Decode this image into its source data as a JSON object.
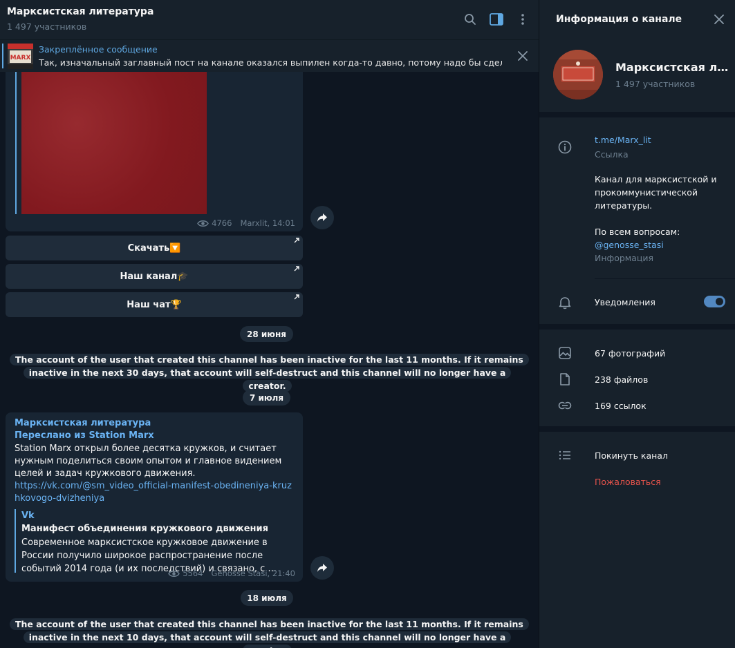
{
  "chat": {
    "title": "Марксистская литература",
    "subtitle": "1 497 участников"
  },
  "pinned": {
    "title": "Закреплённое сообщение",
    "text": "Так, изначальный заглавный пост на канале оказался выпилен когда-то давно, потому надо бы сделать ..."
  },
  "photo_post": {
    "views": "4766",
    "signature": "Marxlit, 14:01"
  },
  "buttons": [
    {
      "label": "Скачать🔽"
    },
    {
      "label": "Наш канал🎓"
    },
    {
      "label": "Наш чат🏆"
    }
  ],
  "dates": {
    "d1": "28 июня",
    "d2": "7 июля",
    "d3": "18 июля"
  },
  "service": {
    "s1": "The account of the user that created this channel has been inactive for the last 11 months. If it remains inactive in the next 30 days, that account will self-destruct and this channel will no longer have a creator.",
    "s2": "The account of the user that created this channel has been inactive for the last 11 months. If it remains inactive in the next 10 days, that account will self-destruct and this channel will no longer have a creator."
  },
  "forward_post": {
    "channel": "Марксистская литература",
    "forwarded_from": "Переслано из Station Marx",
    "text": "Station Marx открыл более десятка кружков, и считает нужным поделиться своим опытом и главное видением целей и задач кружкового движения.",
    "link": "https://vk.com/@sm_video_official-manifest-obedineniya-kruzhkovogo-dvizheniya",
    "preview_site": "Vk",
    "preview_title": "Манифест объединения кружкового движения",
    "preview_desc": "Современное марксистское кружковое движение в России получило широкое распространение после событий 2014 года (и их последствий) и связано, с ...",
    "views": "5564",
    "signature": "Genosse Stasi, 21:40"
  },
  "side": {
    "header": "Информация о канале",
    "name": "Марксистская литература",
    "subtitle": "1 497 участников",
    "link": "t.me/Marx_lit",
    "link_caption": "Ссылка",
    "desc_1": "Канал для марксистской и прокоммунистической литературы.",
    "desc_2": "По всем вопросам:",
    "desc_handle": "@genosse_stasi",
    "info_caption": "Информация",
    "notifications": "Уведомления",
    "notifications_on": true,
    "photos": "67 фотографий",
    "files": "238 файлов",
    "links": "169 ссылок",
    "leave": "Покинуть канал",
    "report": "Пожаловаться"
  },
  "colors": {
    "accent": "#6ab3f3",
    "danger": "#e5534b",
    "bg": "#0e1621",
    "panel": "#17212b"
  }
}
